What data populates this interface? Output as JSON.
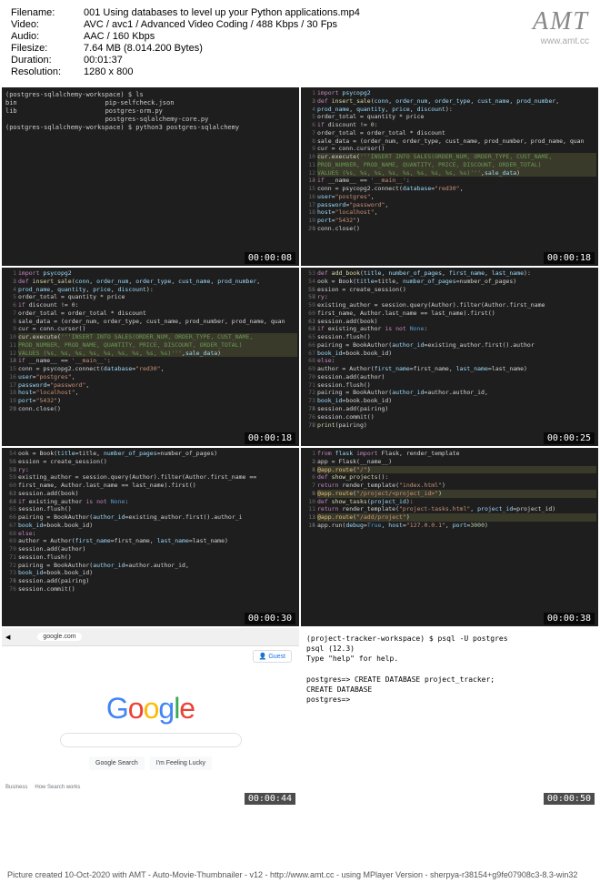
{
  "header": {
    "filename_label": "Filename:",
    "filename": "001 Using databases to level up your Python applications.mp4",
    "video_label": "Video:",
    "video": "AVC / avc1 / Advanced Video Coding / 488 Kbps / 30 Fps",
    "audio_label": "Audio:",
    "audio": "AAC / 160 Kbps",
    "filesize_label": "Filesize:",
    "filesize": "7.64 MB (8.014.200 Bytes)",
    "duration_label": "Duration:",
    "duration": "00:01:37",
    "resolution_label": "Resolution:",
    "resolution": "1280 x 800"
  },
  "logo": {
    "text": "AMT",
    "url": "www.amt.cc"
  },
  "timestamps": [
    "00:00:08",
    "00:00:18",
    "00:00:18",
    "00:00:25",
    "00:00:30",
    "00:00:38",
    "00:00:44",
    "00:00:50"
  ],
  "thumb1_terminal": "(postgres-sqlalchemy-workspace) $ ls\nbin                       pip-selfcheck.json\nlib                       postgres-orm.py\n                          postgres-sqlalchemy-core.py\n(postgres-sqlalchemy-workspace) $ python3 postgres-sqlalchemy",
  "thumb8_terminal": "(project-tracker-workspace) $ psql -U postgres\npsql (12.3)\nType \"help\" for help.\n\npostgres=> CREATE DATABASE project_tracker;\nCREATE DATABASE\npostgres=> ",
  "google": {
    "addr": "google.com",
    "btn1": "Google Search",
    "btn2": "I'm Feeling Lucky",
    "guest": "Guest",
    "footer1": "Business",
    "footer2": "How Search works"
  },
  "footer": "Picture created 10-Oct-2020 with AMT - Auto-Movie-Thumbnailer - v12 - http://www.amt.cc - using MPlayer Version - sherpya-r38154+g9fe07908c3-8.3-win32"
}
